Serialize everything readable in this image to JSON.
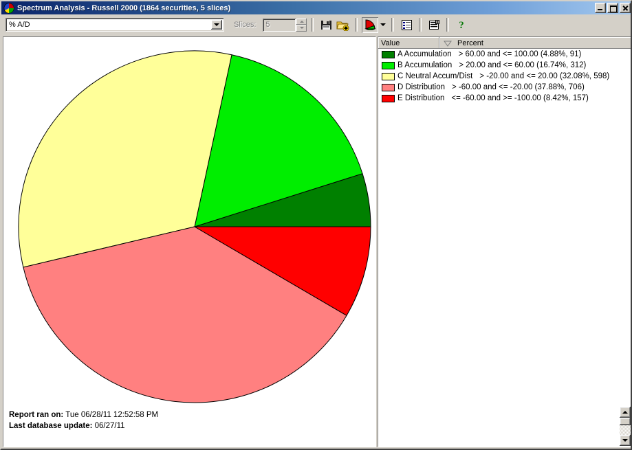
{
  "window": {
    "title": "Spectrum Analysis - Russell 2000 (1864 securities, 5 slices)",
    "icon": "pie-chart-app-icon",
    "buttons": {
      "minimize": "minimize-icon",
      "maximize": "maximize-icon",
      "close": "close-icon"
    }
  },
  "toolbar": {
    "metric_select": {
      "value": "% A/D",
      "arrow": "chevron-down-icon"
    },
    "slices": {
      "label": "Slices:",
      "value": "5",
      "disabled": true
    },
    "buttons": [
      {
        "name": "save-button",
        "icon": "floppy-disk-icon",
        "pressed": false
      },
      {
        "name": "open-button",
        "icon": "open-folder-plus-icon",
        "pressed": false
      },
      {
        "name": "pie-chart-view-button",
        "icon": "pie-chart-icon",
        "pressed": true
      },
      {
        "name": "chart-type-dropdown-button",
        "icon": "chevron-down-icon",
        "pressed": false
      },
      {
        "name": "list-view-button",
        "icon": "list-view-icon",
        "pressed": false
      },
      {
        "name": "report-view-button",
        "icon": "report-view-icon",
        "pressed": false
      },
      {
        "name": "help-button",
        "icon": "question-mark-icon",
        "pressed": false
      }
    ]
  },
  "legend": {
    "columns": [
      {
        "label": "Value",
        "sort": "none"
      },
      {
        "label": "Percent",
        "sort": "descending",
        "sort_icon": "sort-descending-icon"
      }
    ],
    "rows": [
      {
        "color": "#008000",
        "label": "A Accumulation",
        "range": "> 60.00 and <= 100.00 (4.88%, 91)"
      },
      {
        "color": "#00EE00",
        "label": "B Accumulation",
        "range": "> 20.00 and <= 60.00 (16.74%, 312)"
      },
      {
        "color": "#FFFF99",
        "label": "C Neutral Accum/Dist",
        "range": "> -20.00 and <= 20.00 (32.08%, 598)"
      },
      {
        "color": "#FF8080",
        "label": "D Distribution",
        "range": "> -60.00 and <= -20.00 (37.88%, 706)"
      },
      {
        "color": "#FF0000",
        "label": "E Distribution",
        "range": "<= -60.00 and >= -100.00 (8.42%, 157)"
      }
    ]
  },
  "footer": {
    "report_label": "Report ran on:",
    "report_value": "Tue 06/28/11 12:52:58 PM",
    "update_label": "Last database update:",
    "update_value": "06/27/11"
  },
  "scrollbar": {
    "up": "scroll-up-arrow-icon",
    "down": "scroll-down-arrow-icon",
    "thumb": "scrollbar-thumb"
  },
  "chart_data": {
    "type": "pie",
    "title": "Spectrum Analysis - Russell 2000",
    "total_securities": 1864,
    "slice_count": 5,
    "start_angle_deg": 0,
    "direction": "counterclockwise",
    "center": [
      280,
      328
    ],
    "radius": 256,
    "categories": [
      "A Accumulation",
      "B Accumulation",
      "C Neutral Accum/Dist",
      "D Distribution",
      "E Distribution"
    ],
    "values": [
      4.88,
      16.74,
      32.08,
      37.88,
      8.42
    ],
    "counts": [
      91,
      312,
      598,
      706,
      157
    ],
    "colors": [
      "#008000",
      "#00EE00",
      "#FFFF99",
      "#FF8080",
      "#FF0000"
    ],
    "ranges": [
      "> 60.00 and <= 100.00",
      "> 20.00 and <= 60.00",
      "> -20.00 and <= 20.00",
      "> -60.00 and <= -20.00",
      "<= -60.00 and >= -100.00"
    ],
    "xlabel": "",
    "ylabel": "",
    "legend_position": "right",
    "grid": false
  }
}
